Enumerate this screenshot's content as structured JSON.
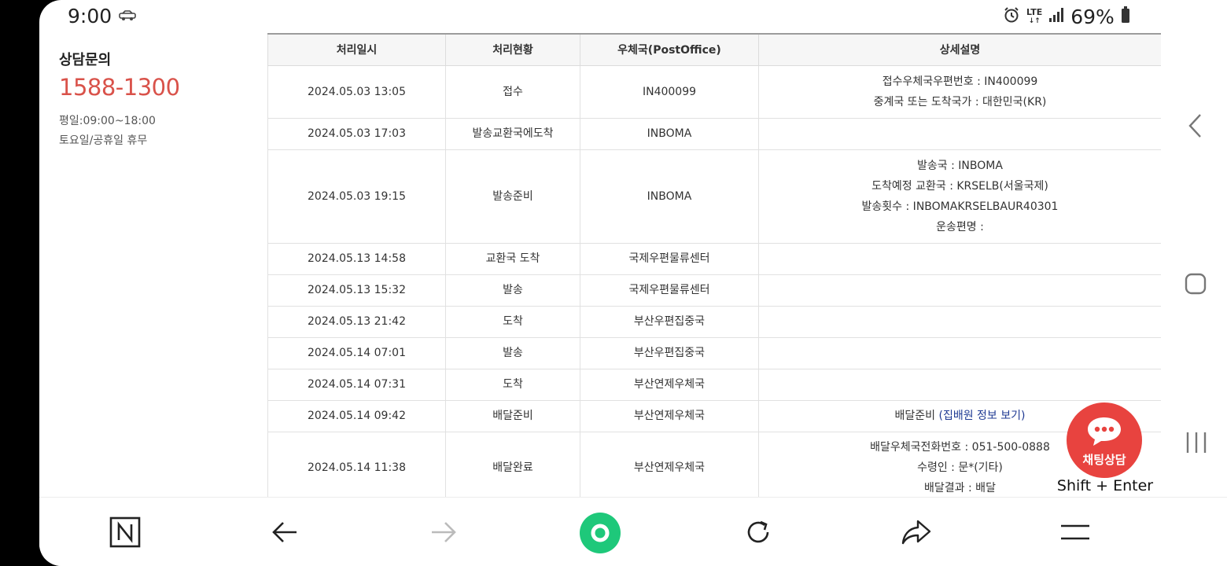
{
  "status_bar": {
    "time": "9:00",
    "network": "LTE",
    "battery": "69%"
  },
  "contact": {
    "title": "상담문의",
    "phone": "1588-1300",
    "hours_weekday": "평일:09:00~18:00",
    "hours_weekend": "토요일/공휴일 휴무"
  },
  "table": {
    "headers": [
      "처리일시",
      "처리현황",
      "우체국(PostOffice)",
      "상세설명"
    ],
    "rows": [
      {
        "datetime": "2024.05.03 13:05",
        "status": "접수",
        "office": "IN400099",
        "details": [
          "접수우체국우편번호 : IN400099",
          "중계국 또는 도착국가 : 대한민국(KR)"
        ]
      },
      {
        "datetime": "2024.05.03 17:03",
        "status": "발송교환국에도착",
        "office": "INBOMA",
        "details": []
      },
      {
        "datetime": "2024.05.03 19:15",
        "status": "발송준비",
        "office": "INBOMA",
        "details": [
          "발송국 : INBOMA",
          "도착예정 교환국 : KRSELB(서울국제)",
          "발송횟수 : INBOMAKRSELBAUR40301",
          "운송편명 :"
        ]
      },
      {
        "datetime": "2024.05.13 14:58",
        "status": "교환국 도착",
        "office": "국제우편물류센터",
        "details": []
      },
      {
        "datetime": "2024.05.13 15:32",
        "status": "발송",
        "office": "국제우편물류센터",
        "details": []
      },
      {
        "datetime": "2024.05.13 21:42",
        "status": "도착",
        "office": "부산우편집중국",
        "details": []
      },
      {
        "datetime": "2024.05.14 07:01",
        "status": "발송",
        "office": "부산우편집중국",
        "details": []
      },
      {
        "datetime": "2024.05.14 07:31",
        "status": "도착",
        "office": "부산연제우체국",
        "details": []
      },
      {
        "datetime": "2024.05.14 09:42",
        "status": "배달준비",
        "office": "부산연제우체국",
        "details": [
          "배달준비"
        ],
        "detail_link": "(집배원 정보 보기)"
      },
      {
        "datetime": "2024.05.14 11:38",
        "status": "배달완료",
        "office": "부산연제우체국",
        "details": [
          "배달우체국전화번호 : 051-500-0888",
          "수령인 : 문*(기타)",
          "배달결과 : 배달"
        ]
      }
    ]
  },
  "chat": {
    "label": "채팅상담",
    "hint": "Shift + Enter"
  },
  "colors": {
    "phone": "#d9524a",
    "chat": "#e8433f",
    "naver_green": "#1ec87a",
    "link": "#1f3a93"
  },
  "bottom_nav": {
    "icons": [
      "naver-n-icon",
      "back-arrow-icon",
      "forward-arrow-icon",
      "naver-green-dot-icon",
      "reload-icon",
      "share-icon",
      "menu-icon"
    ]
  }
}
